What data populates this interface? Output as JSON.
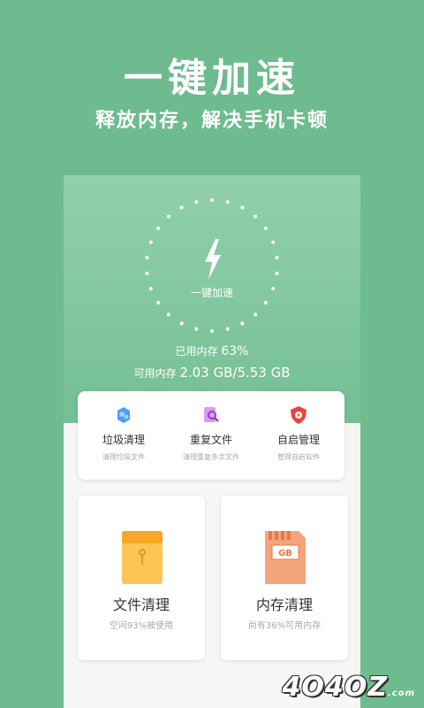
{
  "hero": {
    "title": "一键加速",
    "subtitle": "释放内存，解决手机卡顿"
  },
  "boost": {
    "button_label": "一键加速",
    "used_label": "已用内存",
    "used_value": "63%",
    "free_label": "可用内存",
    "free_value": "2.03 GB/5.53 GB",
    "icon": "lightning-bolt-icon"
  },
  "tools": [
    {
      "name": "垃圾清理",
      "desc": "清理垃圾文件",
      "icon": "trash-clean-icon",
      "color": "#4a9ff0"
    },
    {
      "name": "重复文件",
      "desc": "清理重复多余文件",
      "icon": "duplicate-search-icon",
      "color": "#c86be0"
    },
    {
      "name": "自启管理",
      "desc": "管理自启软件",
      "icon": "shield-autostart-icon",
      "color": "#e8443a"
    }
  ],
  "cards": [
    {
      "title": "文件清理",
      "sub": "空间93%被使用",
      "icon": "folder-file-icon",
      "color": "#f5a623"
    },
    {
      "title": "内存清理",
      "sub": "尚有36%可用内存",
      "icon": "memory-card-icon",
      "color": "#f0895a",
      "badge": "GB"
    }
  ],
  "watermark": {
    "text": "4O4OZ",
    "suffix": ".com"
  },
  "colors": {
    "background": "#6dbb8e",
    "phone_top": "#83c7a0",
    "card_bg": "#ffffff"
  }
}
